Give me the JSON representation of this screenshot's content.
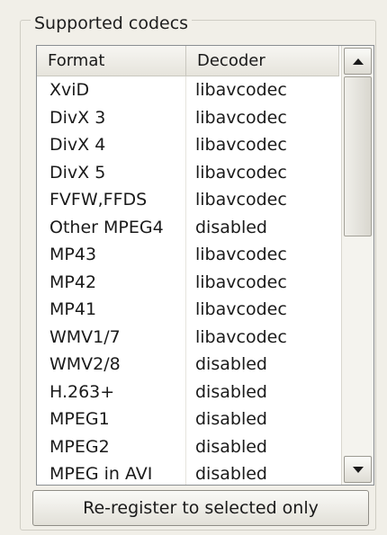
{
  "group": {
    "title": "Supported codecs"
  },
  "list": {
    "columns": {
      "format": "Format",
      "decoder": "Decoder"
    },
    "rows": [
      {
        "format": "XviD",
        "decoder": "libavcodec"
      },
      {
        "format": "DivX 3",
        "decoder": "libavcodec"
      },
      {
        "format": "DivX 4",
        "decoder": "libavcodec"
      },
      {
        "format": "DivX 5",
        "decoder": "libavcodec"
      },
      {
        "format": "FVFW,FFDS",
        "decoder": "libavcodec"
      },
      {
        "format": "Other MPEG4",
        "decoder": "disabled"
      },
      {
        "format": "MP43",
        "decoder": "libavcodec"
      },
      {
        "format": "MP42",
        "decoder": "libavcodec"
      },
      {
        "format": "MP41",
        "decoder": "libavcodec"
      },
      {
        "format": "WMV1/7",
        "decoder": "libavcodec"
      },
      {
        "format": "WMV2/8",
        "decoder": "disabled"
      },
      {
        "format": "H.263+",
        "decoder": "disabled"
      },
      {
        "format": "MPEG1",
        "decoder": "disabled"
      },
      {
        "format": "MPEG2",
        "decoder": "disabled"
      },
      {
        "format": "MPEG in AVI",
        "decoder": "disabled"
      }
    ]
  },
  "scrollbar": {
    "up_icon": "arrow-up-icon",
    "down_icon": "arrow-down-icon"
  },
  "button": {
    "label": "Re-register to selected only"
  }
}
